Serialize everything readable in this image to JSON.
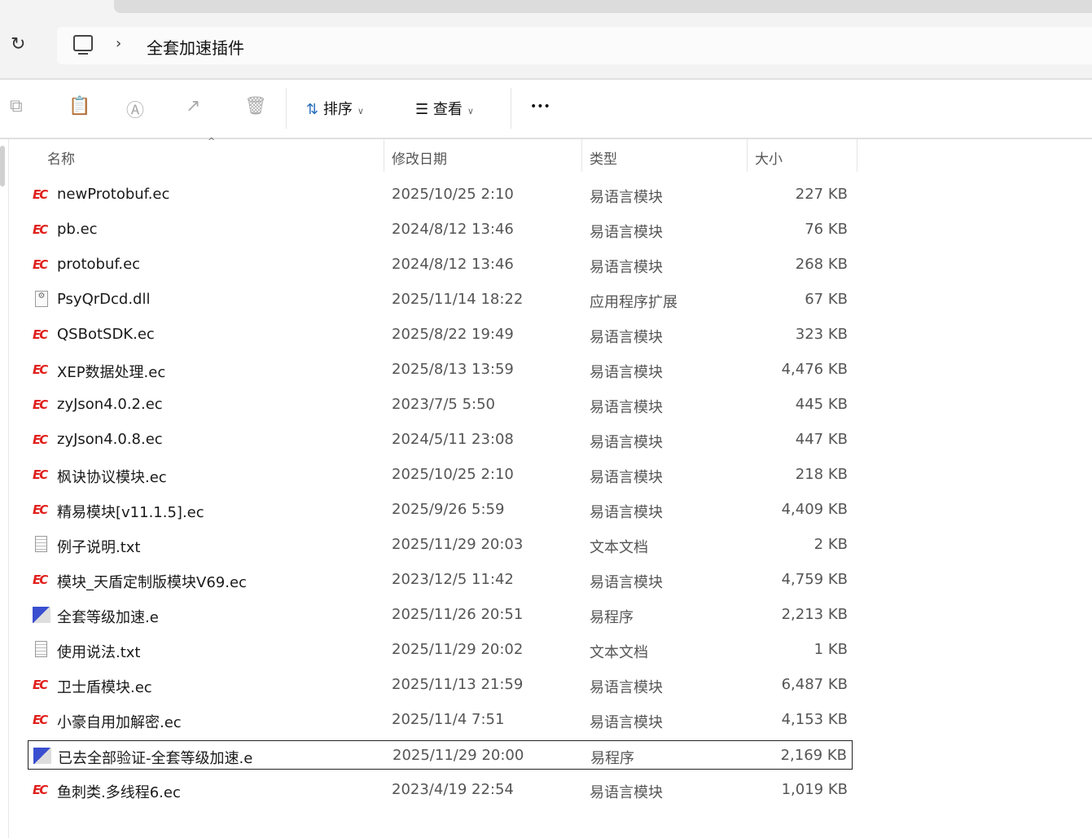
{
  "address": {
    "crumb": "全套加速插件"
  },
  "toolbar": {
    "sort": "排序",
    "view": "查看",
    "more": "•••"
  },
  "columns": {
    "name": "名称",
    "date": "修改日期",
    "type": "类型",
    "size": "大小"
  },
  "files": [
    {
      "name": "newProtobuf.ec",
      "date": "2025/10/25 2:10",
      "type": "易语言模块",
      "size": "227 KB",
      "icon": "ec"
    },
    {
      "name": "pb.ec",
      "date": "2024/8/12 13:46",
      "type": "易语言模块",
      "size": "76 KB",
      "icon": "ec"
    },
    {
      "name": "protobuf.ec",
      "date": "2024/8/12 13:46",
      "type": "易语言模块",
      "size": "268 KB",
      "icon": "ec"
    },
    {
      "name": "PsyQrDcd.dll",
      "date": "2025/11/14 18:22",
      "type": "应用程序扩展",
      "size": "67 KB",
      "icon": "dll"
    },
    {
      "name": "QSBotSDK.ec",
      "date": "2025/8/22 19:49",
      "type": "易语言模块",
      "size": "323 KB",
      "icon": "ec"
    },
    {
      "name": "XEP数据处理.ec",
      "date": "2025/8/13 13:59",
      "type": "易语言模块",
      "size": "4,476 KB",
      "icon": "ec"
    },
    {
      "name": "zyJson4.0.2.ec",
      "date": "2023/7/5 5:50",
      "type": "易语言模块",
      "size": "445 KB",
      "icon": "ec"
    },
    {
      "name": "zyJson4.0.8.ec",
      "date": "2024/5/11 23:08",
      "type": "易语言模块",
      "size": "447 KB",
      "icon": "ec"
    },
    {
      "name": "枫诀协议模块.ec",
      "date": "2025/10/25 2:10",
      "type": "易语言模块",
      "size": "218 KB",
      "icon": "ec"
    },
    {
      "name": "精易模块[v11.1.5].ec",
      "date": "2025/9/26 5:59",
      "type": "易语言模块",
      "size": "4,409 KB",
      "icon": "ec"
    },
    {
      "name": "例子说明.txt",
      "date": "2025/11/29 20:03",
      "type": "文本文档",
      "size": "2 KB",
      "icon": "txt"
    },
    {
      "name": "模块_天盾定制版模块V69.ec",
      "date": "2023/12/5 11:42",
      "type": "易语言模块",
      "size": "4,759 KB",
      "icon": "ec"
    },
    {
      "name": "全套等级加速.e",
      "date": "2025/11/26 20:51",
      "type": "易程序",
      "size": "2,213 KB",
      "icon": "e"
    },
    {
      "name": "使用说法.txt",
      "date": "2025/11/29 20:02",
      "type": "文本文档",
      "size": "1 KB",
      "icon": "txt"
    },
    {
      "name": "卫士盾模块.ec",
      "date": "2025/11/13 21:59",
      "type": "易语言模块",
      "size": "6,487 KB",
      "icon": "ec"
    },
    {
      "name": "小豪自用加解密.ec",
      "date": "2025/11/4 7:51",
      "type": "易语言模块",
      "size": "4,153 KB",
      "icon": "ec"
    },
    {
      "name": "已去全部验证-全套等级加速.e",
      "date": "2025/11/29 20:00",
      "type": "易程序",
      "size": "2,169 KB",
      "icon": "e",
      "selected": true
    },
    {
      "name": "鱼刺类.多线程6.ec",
      "date": "2023/4/19 22:54",
      "type": "易语言模块",
      "size": "1,019 KB",
      "icon": "ec"
    }
  ]
}
